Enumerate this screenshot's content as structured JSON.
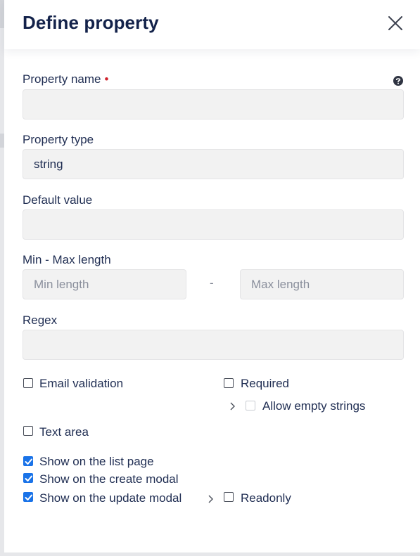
{
  "modal": {
    "title": "Define property"
  },
  "form": {
    "property_name": {
      "label": "Property name",
      "value": ""
    },
    "property_type": {
      "label": "Property type",
      "value": "string"
    },
    "default_value": {
      "label": "Default value",
      "value": ""
    },
    "length": {
      "label": "Min - Max length",
      "min_placeholder": "Min length",
      "separator": "-",
      "max_placeholder": "Max length"
    },
    "regex": {
      "label": "Regex",
      "value": ""
    }
  },
  "options": {
    "email_validation": {
      "label": "Email validation",
      "checked": false
    },
    "required": {
      "label": "Required",
      "checked": false
    },
    "allow_empty_strings": {
      "label": "Allow empty strings",
      "checked": false,
      "disabled": true
    },
    "text_area": {
      "label": "Text area",
      "checked": false
    },
    "show_list": {
      "label": "Show on the list page",
      "checked": true
    },
    "show_create": {
      "label": "Show on the create modal",
      "checked": true
    },
    "show_update": {
      "label": "Show on the update modal",
      "checked": true
    },
    "readonly": {
      "label": "Readonly",
      "checked": false
    }
  },
  "icons": {
    "close": "close-icon",
    "help": "question-circle-icon",
    "expand": "chevron-right-icon"
  },
  "colors": {
    "title": "#13224a",
    "required_dot": "#d0222c",
    "checkbox_checked": "#1a73e8",
    "field_bg": "#f2f2f2"
  }
}
